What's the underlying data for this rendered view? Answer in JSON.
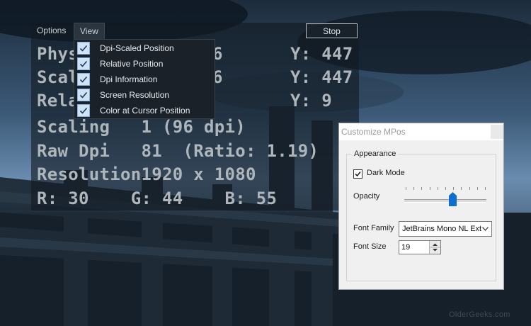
{
  "menu": {
    "options": "Options",
    "view": "View",
    "stop": "Stop"
  },
  "readout": {
    "row1": "Phys",
    "row1_val": "6",
    "row1_y": "Y: 447",
    "row2": "Scal",
    "row2_val": "6",
    "row2_y": "Y: 447",
    "row3": "Rela",
    "row3_y": "Y: 9",
    "row4": "Scaling   1 (96 dpi)",
    "row5": "Raw Dpi   81  (Ratio: 1.19)",
    "row6": "Resolution1920 x 1080",
    "row7": "R: 30    G: 44    B: 55"
  },
  "view_menu": {
    "items": [
      {
        "label": "Dpi-Scaled Position",
        "checked": true
      },
      {
        "label": "Relative Position",
        "checked": true
      },
      {
        "label": "Dpi Information",
        "checked": true
      },
      {
        "label": "Screen Resolution",
        "checked": true
      },
      {
        "label": "Color at Cursor Position",
        "checked": true
      }
    ]
  },
  "dialog": {
    "title": "Customize MPos",
    "group": "Appearance",
    "dark_mode": "Dark Mode",
    "dark_mode_checked": true,
    "opacity": "Opacity",
    "opacity_level": 0.6,
    "font_family_label": "Font Family",
    "font_family_value": "JetBrains Mono NL Ext",
    "font_size_label": "Font Size",
    "font_size_value": "19"
  },
  "watermark": "OlderGeeks.com"
}
